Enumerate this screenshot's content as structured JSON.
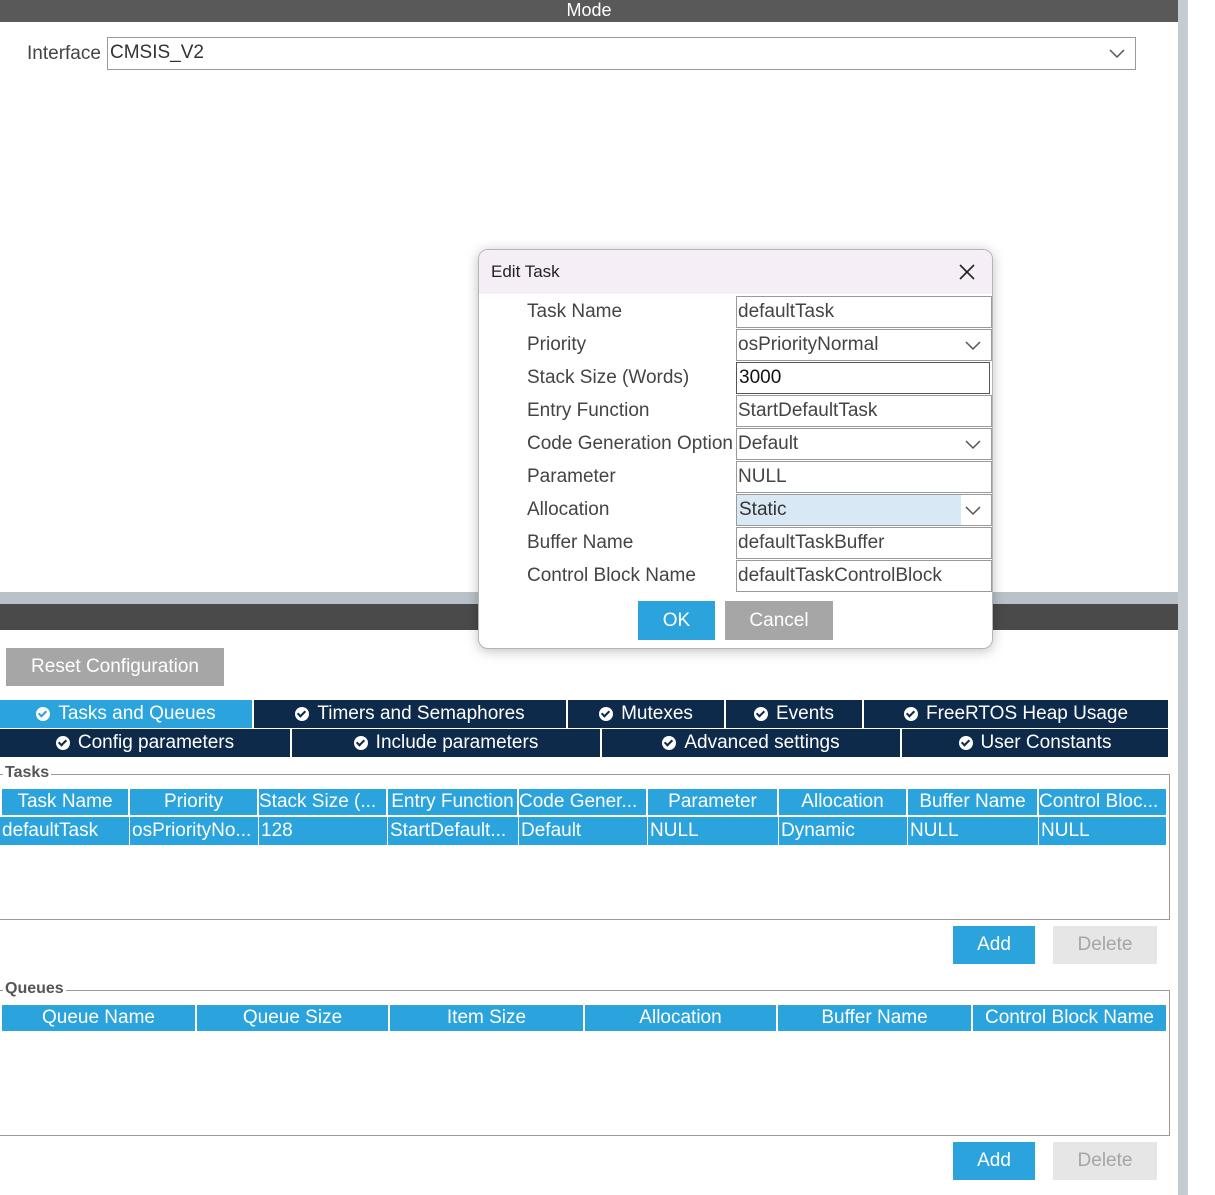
{
  "mode": {
    "title": "Mode",
    "interface_label": "Interface",
    "interface_value": "CMSIS_V2"
  },
  "reset_button": "Reset Configuration",
  "tabs_row1": [
    {
      "label": "Tasks and Queues",
      "active": true
    },
    {
      "label": "Timers and Semaphores",
      "active": false
    },
    {
      "label": "Mutexes",
      "active": false
    },
    {
      "label": "Events",
      "active": false
    },
    {
      "label": "FreeRTOS Heap Usage",
      "active": false
    }
  ],
  "tabs_row2": [
    {
      "label": "Config parameters"
    },
    {
      "label": "Include parameters"
    },
    {
      "label": "Advanced settings"
    },
    {
      "label": "User Constants"
    }
  ],
  "tasks": {
    "group_label": "Tasks",
    "columns": [
      "Task Name",
      "Priority",
      "Stack Size (...",
      "Entry Function",
      "Code Gener...",
      "Parameter",
      "Allocation",
      "Buffer Name",
      "Control Bloc..."
    ],
    "rows": [
      [
        "defaultTask",
        "osPriorityNo...",
        "128",
        "StartDefault...",
        "Default",
        "NULL",
        "Dynamic",
        "NULL",
        "NULL"
      ]
    ],
    "add": "Add",
    "delete": "Delete"
  },
  "queues": {
    "group_label": "Queues",
    "columns": [
      "Queue Name",
      "Queue Size",
      "Item Size",
      "Allocation",
      "Buffer Name",
      "Control Block Name"
    ],
    "add": "Add",
    "delete": "Delete"
  },
  "dialog": {
    "title": "Edit Task",
    "close_icon": "close-icon",
    "fields": [
      {
        "label": "Task Name",
        "value": "defaultTask",
        "kind": "text"
      },
      {
        "label": "Priority",
        "value": "osPriorityNormal",
        "kind": "select"
      },
      {
        "label": "Stack Size (Words)",
        "value": "3000",
        "kind": "text"
      },
      {
        "label": "Entry Function",
        "value": "StartDefaultTask",
        "kind": "text"
      },
      {
        "label": "Code Generation Option",
        "value": "Default",
        "kind": "select"
      },
      {
        "label": "Parameter",
        "value": "NULL",
        "kind": "text"
      },
      {
        "label": "Allocation",
        "value": "Static",
        "kind": "select"
      },
      {
        "label": "Buffer Name",
        "value": "defaultTaskBuffer",
        "kind": "text"
      },
      {
        "label": "Control Block Name",
        "value": "defaultTaskControlBlock",
        "kind": "text"
      }
    ],
    "ok": "OK",
    "cancel": "Cancel"
  },
  "colors": {
    "accent": "#2ba3dd",
    "tab_dark": "#0d2a4a",
    "bar_dark": "#4a4a4a"
  }
}
